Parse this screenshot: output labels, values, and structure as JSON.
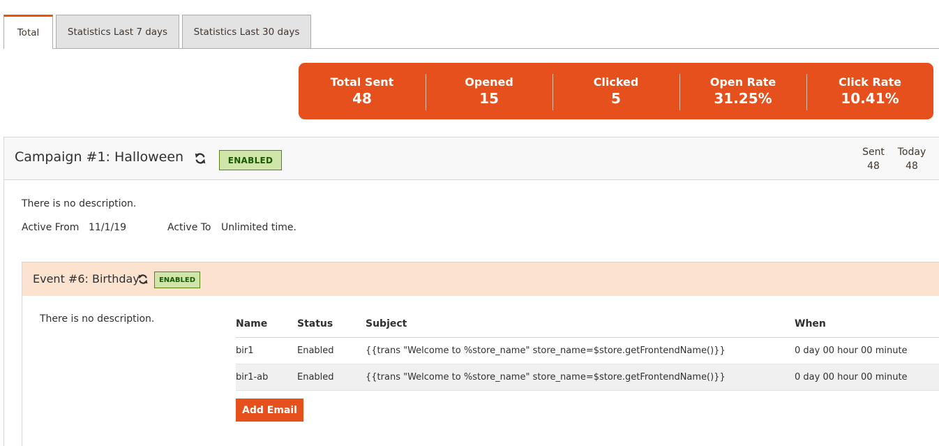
{
  "tabs": [
    {
      "label": "Total",
      "active": true
    },
    {
      "label": "Statistics Last 7 days",
      "active": false
    },
    {
      "label": "Statistics Last 30 days",
      "active": false
    }
  ],
  "stats": [
    {
      "label": "Total Sent",
      "value": "48"
    },
    {
      "label": "Opened",
      "value": "15"
    },
    {
      "label": "Clicked",
      "value": "5"
    },
    {
      "label": "Open Rate",
      "value": "31.25%"
    },
    {
      "label": "Click Rate",
      "value": "10.41%"
    }
  ],
  "campaign": {
    "title": "Campaign #1: Halloween",
    "refresh_icon": "refresh-icon",
    "status": "ENABLED",
    "counters": {
      "sent_label": "Sent",
      "sent_value": "48",
      "today_label": "Today",
      "today_value": "48"
    },
    "description": "There is no description.",
    "active_from_label": "Active From",
    "active_from_value": "11/1/19",
    "active_to_label": "Active To",
    "active_to_value": "Unlimited time."
  },
  "event": {
    "title": "Event #6: Birthday",
    "status": "ENABLED",
    "description": "There is no description.",
    "table": {
      "columns": [
        "Name",
        "Status",
        "Subject",
        "When"
      ],
      "rows": [
        {
          "name": "bir1",
          "status": "Enabled",
          "subject": "{{trans \"Welcome to %store_name\" store_name=$store.getFrontendName()}}",
          "when": "0 day 00 hour 00 minute"
        },
        {
          "name": "bir1-ab",
          "status": "Enabled",
          "subject": "{{trans \"Welcome to %store_name\" store_name=$store.getFrontendName()}}",
          "when": "0 day 00 hour 00 minute"
        }
      ]
    },
    "add_button": "Add Email"
  },
  "colors": {
    "accent": "#e5501c",
    "enabled_bg": "#d0e5a9",
    "event_header_bg": "#fbe3cf"
  }
}
